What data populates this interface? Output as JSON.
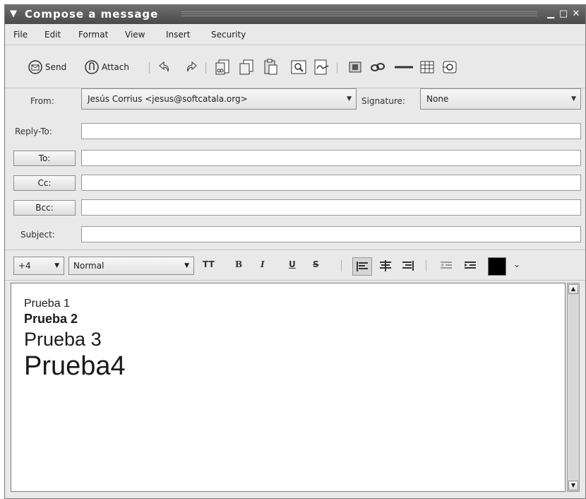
{
  "window": {
    "title": "Compose a message"
  },
  "menu": [
    "File",
    "Edit",
    "Format",
    "View",
    "Insert",
    "Security"
  ],
  "toolbar": {
    "send": "Send",
    "attach": "Attach"
  },
  "headers": {
    "from_label": "From:",
    "from_value": "Jesús Corrius <jesus@softcatala.org>",
    "signature_label": "Signature:",
    "signature_value": "None",
    "replyto_label": "Reply-To:",
    "to_label": "To:",
    "cc_label": "Cc:",
    "bcc_label": "Bcc:",
    "subject_label": "Subject:"
  },
  "format": {
    "size": "+4",
    "style": "Normal",
    "tt": "TT",
    "bold": "B",
    "italic": "I",
    "underline": "U",
    "strike": "S",
    "text_color": "#000000"
  },
  "body_lines": [
    "Prueba 1",
    "Prueba 2",
    "Prueba 3",
    "Prueba4"
  ]
}
